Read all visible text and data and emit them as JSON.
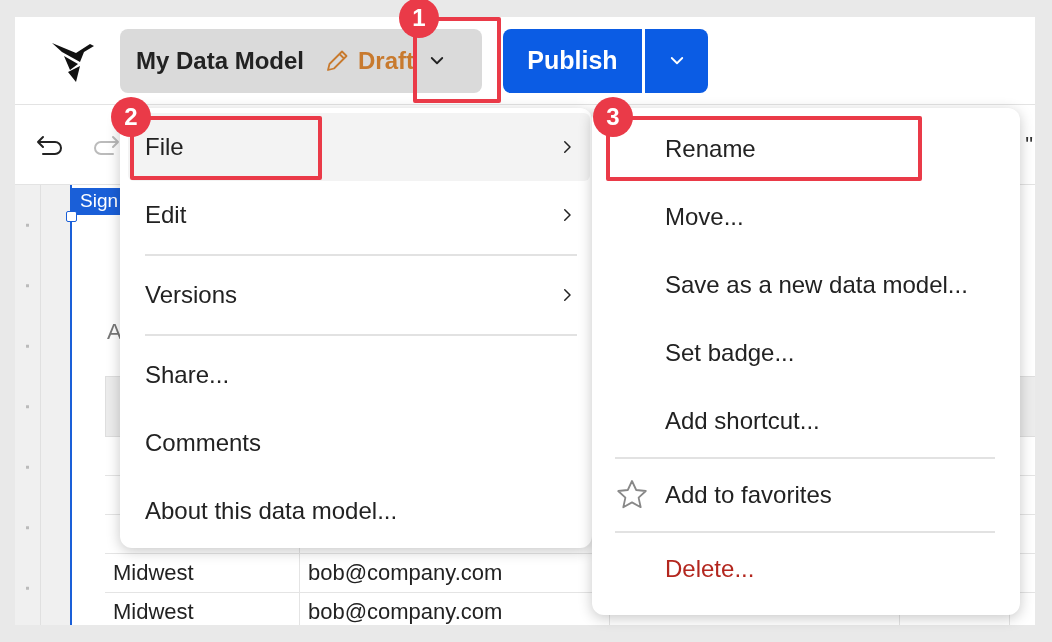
{
  "app_bar": {
    "title": "My Data Model",
    "status": "Draft",
    "publish_button": "Publish"
  },
  "toolbar": {
    "fragment": "\""
  },
  "canvas": {
    "element_tag": "Sign",
    "subtitle": "A",
    "table": {
      "rows": [
        {
          "column_1": "Midwest",
          "column_2": "bob@company.com"
        },
        {
          "column_1": "Midwest",
          "column_2": "bob@company.com"
        }
      ]
    }
  },
  "menu": {
    "groups": [
      [
        {
          "label": "File",
          "selected": true,
          "has_submenu": true
        },
        {
          "label": "Edit",
          "selected": false,
          "has_submenu": true
        }
      ],
      [
        {
          "label": "Versions",
          "selected": false,
          "has_submenu": true
        }
      ],
      [
        {
          "label": "Share...",
          "selected": false,
          "has_submenu": false
        },
        {
          "label": "Comments",
          "selected": false,
          "has_submenu": false
        },
        {
          "label": "About this data model...",
          "selected": false,
          "has_submenu": false
        }
      ]
    ]
  },
  "submenu": {
    "groups": [
      [
        {
          "label": "Rename",
          "kind": "normal"
        },
        {
          "label": "Move...",
          "kind": "normal"
        },
        {
          "label": "Save as a new data model...",
          "kind": "normal"
        },
        {
          "label": "Set badge...",
          "kind": "normal"
        },
        {
          "label": "Add shortcut...",
          "kind": "normal"
        }
      ],
      [
        {
          "label": "Add to favorites",
          "kind": "favorite"
        }
      ],
      [
        {
          "label": "Delete...",
          "kind": "danger"
        }
      ]
    ]
  },
  "annotations": [
    {
      "number": "1"
    },
    {
      "number": "2"
    },
    {
      "number": "3"
    }
  ]
}
